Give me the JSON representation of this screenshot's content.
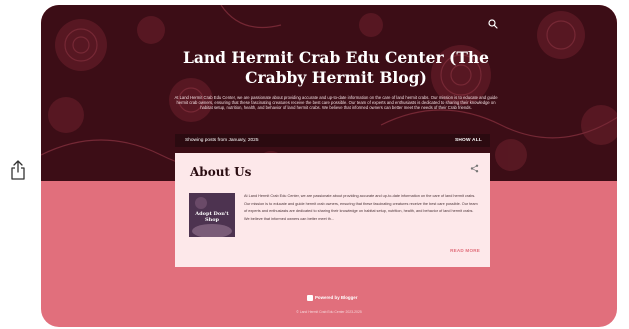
{
  "blog": {
    "title": "Land Hermit Crab Edu Center (The Crabby Hermit Blog)",
    "description": "At Land Hermit Crab Edu Center, we are passionate about providing accurate and up-to-date information on the care of land hermit crabs. Our mission is to educate and guide hermit crab owners, ensuring that these fascinating creatures receive the best care possible. Our team of experts and enthusiasts is dedicated to sharing their knowledge on habitat setup, nutrition, health, and behavior of land hermit crabs. We believe that informed owners can better meet the needs of their Crab friends."
  },
  "posts_bar": {
    "label": "Showing posts from January, 2025",
    "show_all": "SHOW ALL"
  },
  "post": {
    "title": "About Us",
    "thumbnail_text": "Adopt Don't Shop",
    "snippet": "At Land Hermit Crab Edu Center, we are passionate about providing accurate and up-to-date information on the care of land hermit crabs. Our mission is to educate and guide hermit crab owners, ensuring that these fascinating creatures receive the best care possible. Our team of experts and enthusiasts are dedicated to sharing their knowledge on habitat setup, nutrition, health, and behavior of land hermit crabs. We believe that informed owners can better meet th...",
    "read_more": "READ MORE"
  },
  "footer": {
    "powered": "Powered by Blogger",
    "copyright": "© Land Hermit Crab Edu Center 2023-2025"
  },
  "icons": {
    "page_share": "share-icon",
    "search": "search-icon",
    "post_share": "share-icon",
    "blogger": "blogger-logo-icon"
  },
  "colors": {
    "header_bg": "#3c0d16",
    "page_bg": "#e16f7c",
    "card_bg": "#fde8ea",
    "accent": "#e16f7c"
  }
}
